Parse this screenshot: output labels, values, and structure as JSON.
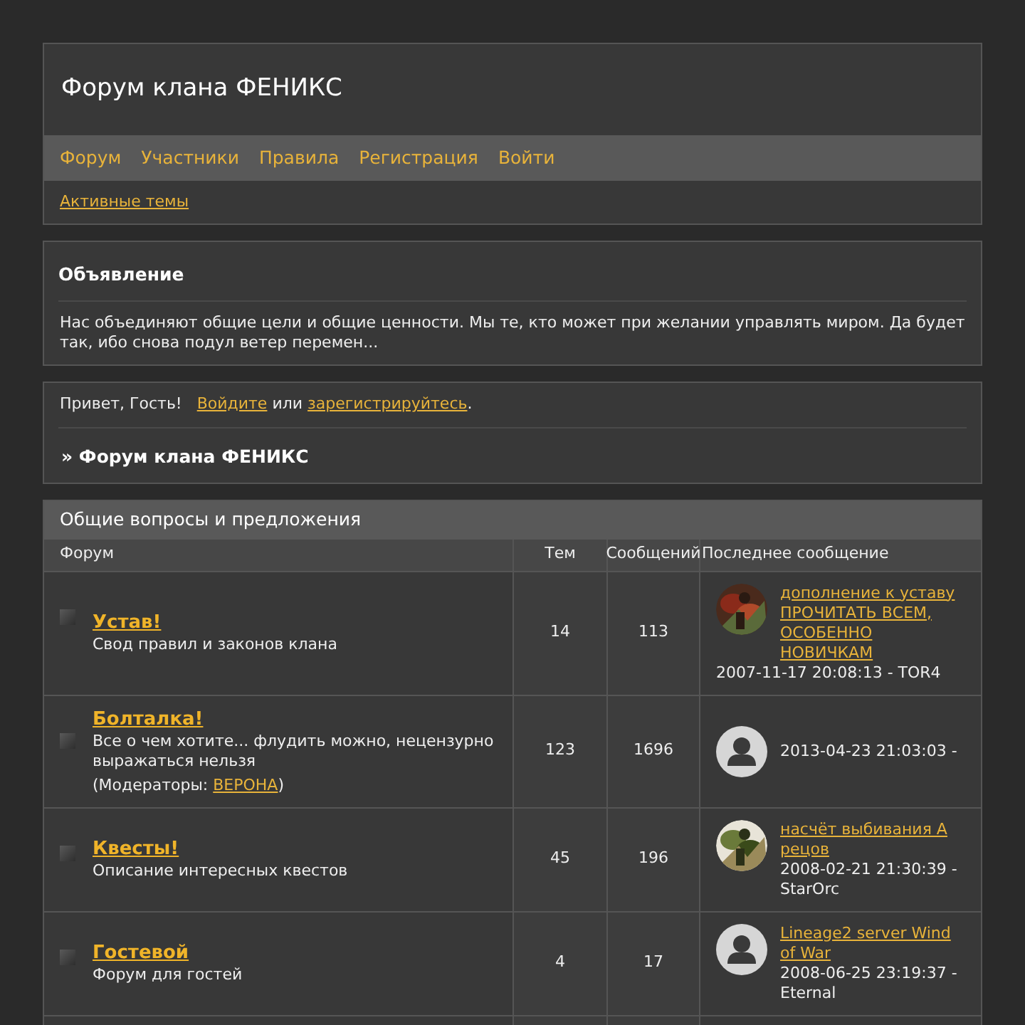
{
  "header": {
    "title": "Форум клана ФЕНИКС"
  },
  "nav": [
    {
      "label": "Форум"
    },
    {
      "label": "Участники"
    },
    {
      "label": "Правила"
    },
    {
      "label": "Регистрация"
    },
    {
      "label": "Войти"
    }
  ],
  "subnav": [
    {
      "label": "Активные темы"
    }
  ],
  "announcement": {
    "title": "Объявление",
    "text": "Нас объединяют общие цели и общие ценности. Мы те, кто может при желании управлять миром. Да будет так, ибо снова подул ветер перемен..."
  },
  "welcome": {
    "greeting": "Привет, Гость!",
    "login_link": "Войдите",
    "or": "или",
    "register_link": "зарегистрируйтесь",
    "end": "."
  },
  "breadcrumb": "» Форум клана ФЕНИКС",
  "category": {
    "title": "Общие вопросы и предложения",
    "columns": [
      "Форум",
      "Тем",
      "Сообщений",
      "Последнее сообщение"
    ],
    "forums": [
      {
        "name": "Устав!",
        "description": "Свод правил и законов клана",
        "topics": "14",
        "posts": "113",
        "last_post": {
          "link": "дополнение к уставу ПРОЧИТАТЬ ВСЕМ, ОСОБЕННО НОВИЧКАМ",
          "info": "2007-11-17 20:08:13 - TOR4"
        }
      },
      {
        "name": "Болталка!",
        "description": "Все о чем хотите... флудить можно, нецензурно выражаться нельзя",
        "moderators": {
          "label": "(Модераторы:",
          "name": "ВЕРОНА",
          "close": ")"
        },
        "topics": "123",
        "posts": "1696",
        "last_post": {
          "avatar": {
            "kind": "default"
          },
          "info": "2013-04-23 21:03:03 -"
        }
      },
      {
        "name": "Квесты!",
        "description": "Описание интересных квестов",
        "topics": "45",
        "posts": "196",
        "last_post": {
          "link": "насчёт выбивания А рецов",
          "info": "2008-02-21 21:30:39 - StarOrc"
        }
      },
      {
        "name": "Гостевой",
        "description": "Форум для гостей",
        "topics": "4",
        "posts": "17",
        "last_post": {
          "avatar": {
            "kind": "default"
          },
          "link": "Lineage2 server Wind of War",
          "info": "2008-06-25 23:19:37 - Eternal"
        }
      }
    ]
  }
}
